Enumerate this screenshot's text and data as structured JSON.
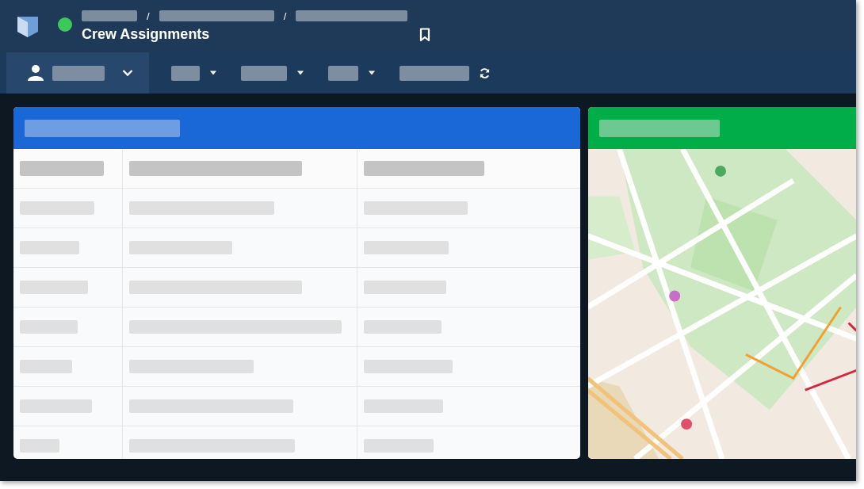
{
  "header": {
    "title": "Crew Assignments",
    "online": true,
    "breadcrumb_separators": [
      "/",
      "/"
    ]
  },
  "toolbar": {
    "dropdowns": [
      {
        "kind": "user"
      },
      {
        "kind": "filter"
      },
      {
        "kind": "filter"
      },
      {
        "kind": "filter"
      },
      {
        "kind": "refresh"
      }
    ]
  },
  "table": {
    "rows": [
      {
        "kind": "skeleton"
      },
      {
        "kind": "skeleton"
      },
      {
        "kind": "skeleton"
      },
      {
        "kind": "skeleton"
      },
      {
        "kind": "skeleton"
      },
      {
        "kind": "skeleton"
      },
      {
        "kind": "skeleton"
      }
    ]
  }
}
